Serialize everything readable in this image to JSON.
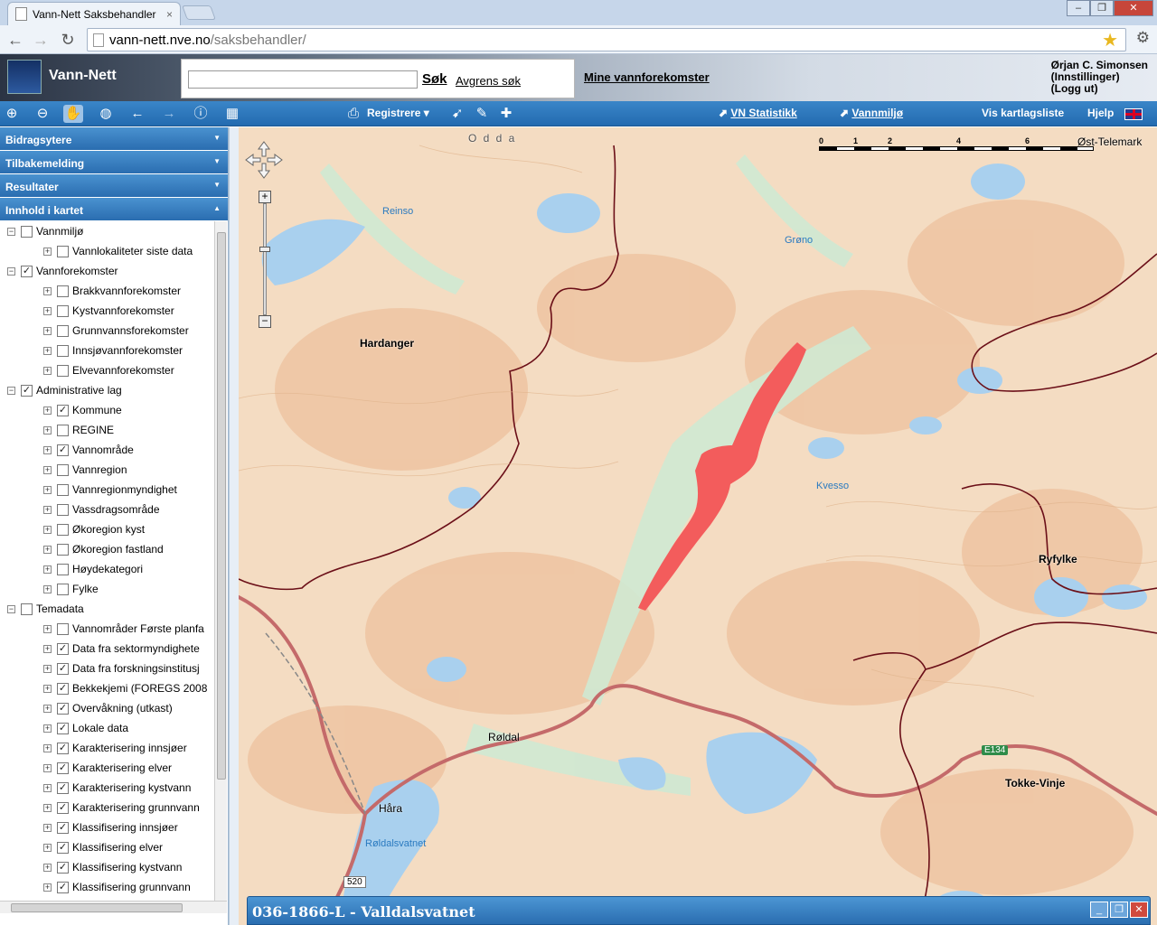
{
  "browser": {
    "tab_title": "Vann-Nett Saksbehandler",
    "tab_close": "×",
    "url_domain": "vann-nett.nve.no",
    "url_path": "/saksbehandler/",
    "back": "←",
    "forward": "→",
    "reload": "↻",
    "star": "★",
    "wrench": "🔧"
  },
  "header": {
    "app_name": "Vann-Nett",
    "search_placeholder": "",
    "search_button": "Søk",
    "refine_search": "Avgrens søk",
    "my_waterbodies": "Mine vannforekomster",
    "user_name": "Ørjan C. Simonsen",
    "settings": "(Innstillinger)",
    "logout": "(Logg ut)"
  },
  "toolbar": {
    "register": "Registrere",
    "vn_statistics": "VN Statistikk",
    "water_environment": "Vannmiljø",
    "show_layer_list": "Vis kartlagsliste",
    "help": "Hjelp"
  },
  "accordion": {
    "contributors": "Bidragsytere",
    "feedback": "Tilbakemelding",
    "results": "Resultater",
    "map_contents": "Innhold i kartet"
  },
  "layers": [
    {
      "label": "Vannmiljø",
      "level": 0,
      "checked": false,
      "exp": "−"
    },
    {
      "label": "Vannlokaliteter siste data",
      "level": 1,
      "checked": false,
      "exp": "+"
    },
    {
      "label": "Vannforekomster",
      "level": 0,
      "checked": true,
      "exp": "−"
    },
    {
      "label": "Brakkvannforekomster",
      "level": 1,
      "checked": false,
      "exp": "+"
    },
    {
      "label": "Kystvannforekomster",
      "level": 1,
      "checked": false,
      "exp": "+"
    },
    {
      "label": "Grunnvannsforekomster",
      "level": 1,
      "checked": false,
      "exp": "+"
    },
    {
      "label": "Innsjøvannforekomster",
      "level": 1,
      "checked": false,
      "exp": "+"
    },
    {
      "label": "Elvevannforekomster",
      "level": 1,
      "checked": false,
      "exp": "+"
    },
    {
      "label": "Administrative lag",
      "level": 0,
      "checked": true,
      "exp": "−"
    },
    {
      "label": "Kommune",
      "level": 1,
      "checked": true,
      "exp": "+"
    },
    {
      "label": "REGINE",
      "level": 1,
      "checked": false,
      "exp": "+"
    },
    {
      "label": "Vannområde",
      "level": 1,
      "checked": true,
      "exp": "+"
    },
    {
      "label": "Vannregion",
      "level": 1,
      "checked": false,
      "exp": "+"
    },
    {
      "label": "Vannregionmyndighet",
      "level": 1,
      "checked": false,
      "exp": "+"
    },
    {
      "label": "Vassdragsområde",
      "level": 1,
      "checked": false,
      "exp": "+"
    },
    {
      "label": "Økoregion kyst",
      "level": 1,
      "checked": false,
      "exp": "+"
    },
    {
      "label": "Økoregion fastland",
      "level": 1,
      "checked": false,
      "exp": "+"
    },
    {
      "label": "Høydekategori",
      "level": 1,
      "checked": false,
      "exp": "+"
    },
    {
      "label": "Fylke",
      "level": 1,
      "checked": false,
      "exp": "+"
    },
    {
      "label": "Temadata",
      "level": 0,
      "checked": false,
      "exp": "−"
    },
    {
      "label": "Vannområder Første planfa",
      "level": 1,
      "checked": false,
      "exp": "+"
    },
    {
      "label": "Data fra sektormyndighete",
      "level": 1,
      "checked": true,
      "exp": "+"
    },
    {
      "label": "Data fra forskningsinstitusj",
      "level": 1,
      "checked": true,
      "exp": "+"
    },
    {
      "label": "Bekkekjemi (FOREGS 2008",
      "level": 1,
      "checked": true,
      "exp": "+"
    },
    {
      "label": "Overvåkning (utkast)",
      "level": 1,
      "checked": true,
      "exp": "+"
    },
    {
      "label": "Lokale data",
      "level": 1,
      "checked": true,
      "exp": "+"
    },
    {
      "label": "Karakterisering innsjøer",
      "level": 1,
      "checked": true,
      "exp": "+"
    },
    {
      "label": "Karakterisering elver",
      "level": 1,
      "checked": true,
      "exp": "+"
    },
    {
      "label": "Karakterisering kystvann",
      "level": 1,
      "checked": true,
      "exp": "+"
    },
    {
      "label": "Karakterisering grunnvann",
      "level": 1,
      "checked": true,
      "exp": "+"
    },
    {
      "label": "Klassifisering innsjøer",
      "level": 1,
      "checked": true,
      "exp": "+"
    },
    {
      "label": "Klassifisering elver",
      "level": 1,
      "checked": true,
      "exp": "+"
    },
    {
      "label": "Klassifisering kystvann",
      "level": 1,
      "checked": true,
      "exp": "+"
    },
    {
      "label": "Klassifisering grunnvann",
      "level": 1,
      "checked": true,
      "exp": "+"
    }
  ],
  "map": {
    "scale_ticks": [
      "0",
      "1",
      "2",
      "4",
      "6"
    ],
    "labels": {
      "odda": "O d d a",
      "ost_telemark": "Øst-Telemark",
      "reinso": "Reinso",
      "grono": "Grøno",
      "hardanger": "Hardanger",
      "kvesso": "Kvesso",
      "ryfylke": "Ryfylke",
      "roldal": "Røldal",
      "hara": "Håra",
      "roldalsvatnet": "Røldalsvatnet",
      "tokke_vinje": "Tokke-Vinje",
      "e134": "E134",
      "r520": "520"
    },
    "highlight_color": "#f35c5c",
    "border_color": "#6b0f18",
    "road_color": "#c46a6a",
    "lake_color": "#a9d0ee"
  },
  "info_window": {
    "title": "036-1866-L - Valldalsvatnet"
  }
}
